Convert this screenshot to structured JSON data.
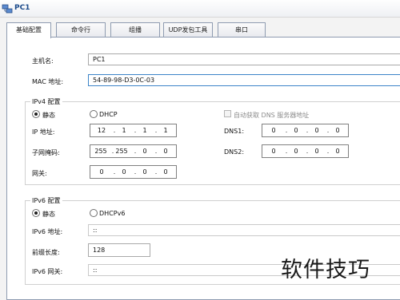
{
  "window": {
    "title": "PC1",
    "icon": "network-pc-icon"
  },
  "tabs": [
    {
      "label": "基础配置"
    },
    {
      "label": "命令行"
    },
    {
      "label": "组播"
    },
    {
      "label": "UDP发包工具"
    },
    {
      "label": "串口"
    }
  ],
  "basic": {
    "hostname_label": "主机名:",
    "hostname_value": "PC1",
    "mac_label": "MAC 地址:",
    "mac_value": "54-89-98-D3-0C-03"
  },
  "ipv4": {
    "group_title": "IPv4 配置",
    "static_label": "静态",
    "dhcp_label": "DHCP",
    "auto_dns_label": "自动获取 DNS 服务器地址",
    "ip_label": "IP 地址:",
    "ip_parts": [
      "12",
      "1",
      "1",
      "1"
    ],
    "mask_label": "子网掩码:",
    "mask_parts": [
      "255",
      "255",
      "0",
      "0"
    ],
    "gateway_label": "网关:",
    "gateway_parts": [
      "0",
      "0",
      "0",
      "0"
    ],
    "dns1_label": "DNS1:",
    "dns1_parts": [
      "0",
      "0",
      "0",
      "0"
    ],
    "dns2_label": "DNS2:",
    "dns2_parts": [
      "0",
      "0",
      "0",
      "0"
    ]
  },
  "ipv6": {
    "group_title": "IPv6 配置",
    "static_label": "静态",
    "dhcp_label": "DHCPv6",
    "addr_label": "IPv6 地址:",
    "addr_value": "::",
    "prefix_label": "前缀长度:",
    "prefix_value": "128",
    "gateway_label": "IPv6 网关:",
    "gateway_value": "::"
  },
  "watermark": "软件技巧"
}
